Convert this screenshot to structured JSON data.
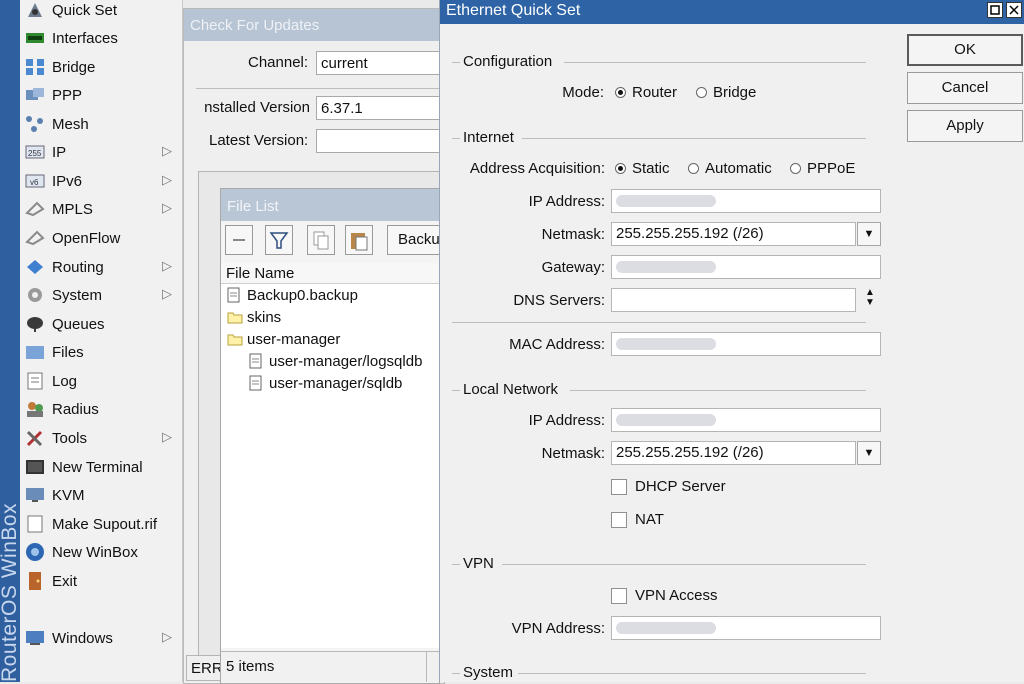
{
  "brand": "RouterOS WinBox",
  "sidebar": {
    "items": [
      {
        "label": "Quick Set",
        "icon": "quick-set-icon",
        "submenu": false
      },
      {
        "label": "Interfaces",
        "icon": "interfaces-icon",
        "submenu": false
      },
      {
        "label": "Bridge",
        "icon": "bridge-icon",
        "submenu": false
      },
      {
        "label": "PPP",
        "icon": "ppp-icon",
        "submenu": false
      },
      {
        "label": "Mesh",
        "icon": "mesh-icon",
        "submenu": false
      },
      {
        "label": "IP",
        "icon": "ip-icon",
        "submenu": true
      },
      {
        "label": "IPv6",
        "icon": "ipv6-icon",
        "submenu": true
      },
      {
        "label": "MPLS",
        "icon": "mpls-icon",
        "submenu": true
      },
      {
        "label": "OpenFlow",
        "icon": "openflow-icon",
        "submenu": false
      },
      {
        "label": "Routing",
        "icon": "routing-icon",
        "submenu": true
      },
      {
        "label": "System",
        "icon": "gear-icon",
        "submenu": true
      },
      {
        "label": "Queues",
        "icon": "queues-icon",
        "submenu": false
      },
      {
        "label": "Files",
        "icon": "folder-icon",
        "submenu": false
      },
      {
        "label": "Log",
        "icon": "log-icon",
        "submenu": false
      },
      {
        "label": "Radius",
        "icon": "radius-icon",
        "submenu": false
      },
      {
        "label": "Tools",
        "icon": "tools-icon",
        "submenu": true
      },
      {
        "label": "New Terminal",
        "icon": "terminal-icon",
        "submenu": false
      },
      {
        "label": "KVM",
        "icon": "kvm-icon",
        "submenu": false
      },
      {
        "label": "Make Supout.rif",
        "icon": "document-icon",
        "submenu": false
      },
      {
        "label": "New WinBox",
        "icon": "winbox-icon",
        "submenu": false
      },
      {
        "label": "Exit",
        "icon": "exit-icon",
        "submenu": false
      },
      {
        "label": "Windows",
        "icon": "windows-icon",
        "submenu": true
      }
    ]
  },
  "updates": {
    "title": "Check For Updates",
    "channel_label": "Channel:",
    "channel_value": "current",
    "installed_label": "Installed Version:",
    "installed_value": "6.37.1",
    "latest_label": "Latest Version:",
    "latest_value": "",
    "status_fragment": "ERR"
  },
  "file_list": {
    "title": "File List",
    "backup_button": "Backup",
    "column_name": "File Name",
    "files": [
      {
        "name": "Backup0.backup",
        "type": "file",
        "indent": 0
      },
      {
        "name": "skins",
        "type": "folder",
        "indent": 0
      },
      {
        "name": "user-manager",
        "type": "folder",
        "indent": 0
      },
      {
        "name": "user-manager/logsqldb",
        "type": "file",
        "indent": 1
      },
      {
        "name": "user-manager/sqldb",
        "type": "file",
        "indent": 1
      }
    ],
    "footer": "5 items"
  },
  "quickset": {
    "title": "Ethernet Quick Set",
    "buttons": {
      "ok": "OK",
      "cancel": "Cancel",
      "apply": "Apply"
    },
    "configuration": {
      "heading": "Configuration",
      "mode_label": "Mode:",
      "mode_options": [
        "Router",
        "Bridge"
      ],
      "mode_selected": "Router"
    },
    "internet": {
      "heading": "Internet",
      "acq_label": "Address Acquisition:",
      "acq_options": [
        "Static",
        "Automatic",
        "PPPoE"
      ],
      "acq_selected": "Static",
      "ip_label": "IP Address:",
      "ip_value": "",
      "netmask_label": "Netmask:",
      "netmask_value": "255.255.255.192 (/26)",
      "gateway_label": "Gateway:",
      "gateway_value": "",
      "dns_label": "DNS Servers:",
      "dns_value": "",
      "mac_label": "MAC Address:",
      "mac_value": ""
    },
    "local": {
      "heading": "Local Network",
      "ip_label": "IP Address:",
      "ip_value": "",
      "netmask_label": "Netmask:",
      "netmask_value": "255.255.255.192 (/26)",
      "dhcp_label": "DHCP Server",
      "dhcp_checked": false,
      "nat_label": "NAT",
      "nat_checked": false
    },
    "vpn": {
      "heading": "VPN",
      "access_label": "VPN Access",
      "access_checked": false,
      "address_label": "VPN Address:",
      "address_value": ""
    },
    "system": {
      "heading": "System"
    }
  }
}
